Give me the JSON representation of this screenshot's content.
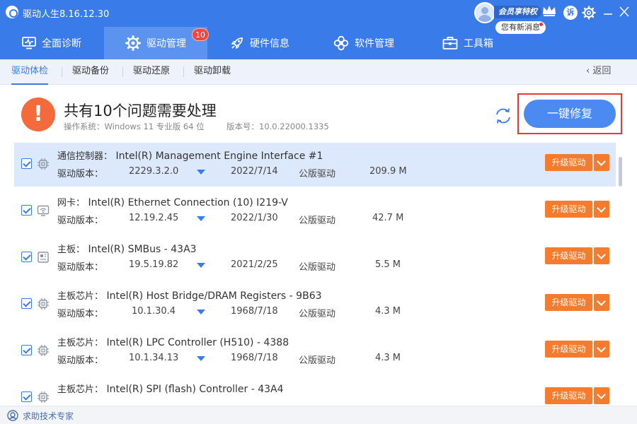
{
  "app": {
    "title": "驱动人生8.16.12.30"
  },
  "vip": {
    "badge": "会员享特权",
    "message": "您有新消息",
    "complain": "诉"
  },
  "nav": {
    "tabs": [
      {
        "label": "全面诊断",
        "icon": "monitor-icon"
      },
      {
        "label": "驱动管理",
        "icon": "gear-icon",
        "badge": "10",
        "active": true
      },
      {
        "label": "硬件信息",
        "icon": "rocket-icon"
      },
      {
        "label": "软件管理",
        "icon": "flower-icon"
      },
      {
        "label": "工具箱",
        "icon": "toolbox-icon"
      }
    ]
  },
  "subtabs": {
    "items": [
      "驱动体检",
      "驱动备份",
      "驱动还原",
      "驱动卸载"
    ],
    "back": "返回"
  },
  "summary": {
    "title": "共有10个问题需要处理",
    "os": "操作系统：Windows 11 专业版 64 位",
    "version": "版本号：10.0.22000.1335",
    "fix_button": "一键修复"
  },
  "drivers": {
    "version_label": "驱动版本：",
    "upgrade_label": "升级驱动",
    "rows": [
      {
        "category": "通信控制器：",
        "name": "Intel(R) Management Engine Interface #1",
        "version": "2229.3.2.0",
        "date": "2022/7/14",
        "type": "公版驱动",
        "size": "209.9 M",
        "icon": "chip-icon"
      },
      {
        "category": "网卡：",
        "name": "Intel(R) Ethernet Connection (10) I219-V",
        "version": "12.19.2.45",
        "date": "2022/1/30",
        "type": "公版驱动",
        "size": "42.7 M",
        "icon": "network-card-icon"
      },
      {
        "category": "主板：",
        "name": "Intel(R) SMBus - 43A3",
        "version": "19.5.19.82",
        "date": "2021/2/25",
        "type": "公版驱动",
        "size": "5.5 M",
        "icon": "motherboard-icon"
      },
      {
        "category": "主板芯片：",
        "name": "Intel(R) Host Bridge/DRAM Registers - 9B63",
        "version": "10.1.30.4",
        "date": "1968/7/18",
        "type": "公版驱动",
        "size": "4.3 M",
        "icon": "chip-icon"
      },
      {
        "category": "主板芯片：",
        "name": "Intel(R) LPC Controller (H510) - 4388",
        "version": "10.1.34.13",
        "date": "1968/7/18",
        "type": "公版驱动",
        "size": "4.3 M",
        "icon": "chip-icon"
      },
      {
        "category": "主板芯片：",
        "name": "Intel(R) SPI (flash) Controller - 43A4",
        "version": "",
        "date": "",
        "type": "",
        "size": "",
        "icon": "chip-icon"
      }
    ]
  },
  "footer": {
    "help": "求助技术专家"
  },
  "colors": {
    "header": "#3a7bea",
    "active_tab": "#5b93ef",
    "warning": "#f46a3b",
    "upgrade": "#f57c2e",
    "highlight": "#e53935"
  }
}
